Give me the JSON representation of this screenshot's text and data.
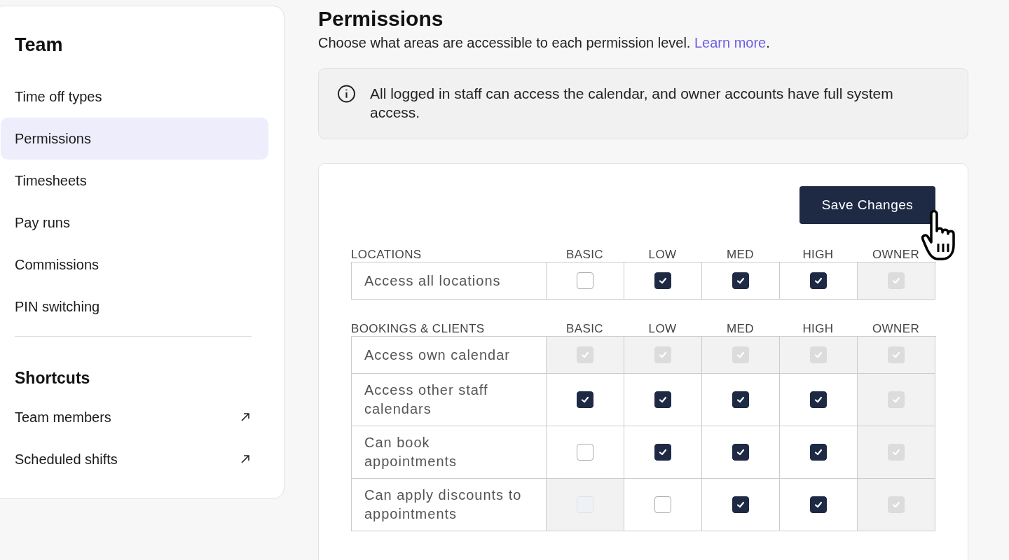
{
  "sidebar": {
    "title": "Team",
    "items": [
      {
        "label": "Time off types",
        "selected": false
      },
      {
        "label": "Permissions",
        "selected": true
      },
      {
        "label": "Timesheets",
        "selected": false
      },
      {
        "label": "Pay runs",
        "selected": false
      },
      {
        "label": "Commissions",
        "selected": false
      },
      {
        "label": "PIN switching",
        "selected": false
      }
    ],
    "shortcuts_title": "Shortcuts",
    "shortcuts": [
      {
        "label": "Team members"
      },
      {
        "label": "Scheduled shifts"
      }
    ]
  },
  "page": {
    "title": "Permissions",
    "subtitle": "Choose what areas are accessible to each permission level.",
    "link": "Learn more",
    "link_suffix": "."
  },
  "info": "All logged in staff can access the calendar, and owner accounts have full system access.",
  "save_button": "Save Changes",
  "sections": [
    {
      "title": "LOCATIONS",
      "columns": [
        "BASIC",
        "LOW",
        "MED",
        "HIGH",
        "OWNER"
      ],
      "rows": [
        {
          "label": "Access all locations",
          "cells": [
            {
              "checked": false,
              "disabled": false
            },
            {
              "checked": true,
              "disabled": false
            },
            {
              "checked": true,
              "disabled": false
            },
            {
              "checked": true,
              "disabled": false
            },
            {
              "checked": true,
              "disabled": true
            }
          ]
        }
      ]
    },
    {
      "title": "BOOKINGS & CLIENTS",
      "columns": [
        "BASIC",
        "LOW",
        "MED",
        "HIGH",
        "OWNER"
      ],
      "rows": [
        {
          "label": "Access own calendar",
          "cells": [
            {
              "checked": true,
              "disabled": true
            },
            {
              "checked": true,
              "disabled": true
            },
            {
              "checked": true,
              "disabled": true
            },
            {
              "checked": true,
              "disabled": true
            },
            {
              "checked": true,
              "disabled": true
            }
          ]
        },
        {
          "label": "Access other staff calendars",
          "cells": [
            {
              "checked": true,
              "disabled": false
            },
            {
              "checked": true,
              "disabled": false
            },
            {
              "checked": true,
              "disabled": false
            },
            {
              "checked": true,
              "disabled": false
            },
            {
              "checked": true,
              "disabled": true
            }
          ]
        },
        {
          "label": "Can book appointments",
          "cells": [
            {
              "checked": false,
              "disabled": false
            },
            {
              "checked": true,
              "disabled": false
            },
            {
              "checked": true,
              "disabled": false
            },
            {
              "checked": true,
              "disabled": false
            },
            {
              "checked": true,
              "disabled": true
            }
          ]
        },
        {
          "label": "Can apply discounts to appointments",
          "cells": [
            {
              "checked": false,
              "disabled": true
            },
            {
              "checked": false,
              "disabled": false
            },
            {
              "checked": true,
              "disabled": false
            },
            {
              "checked": true,
              "disabled": false
            },
            {
              "checked": true,
              "disabled": true
            }
          ]
        }
      ]
    }
  ]
}
